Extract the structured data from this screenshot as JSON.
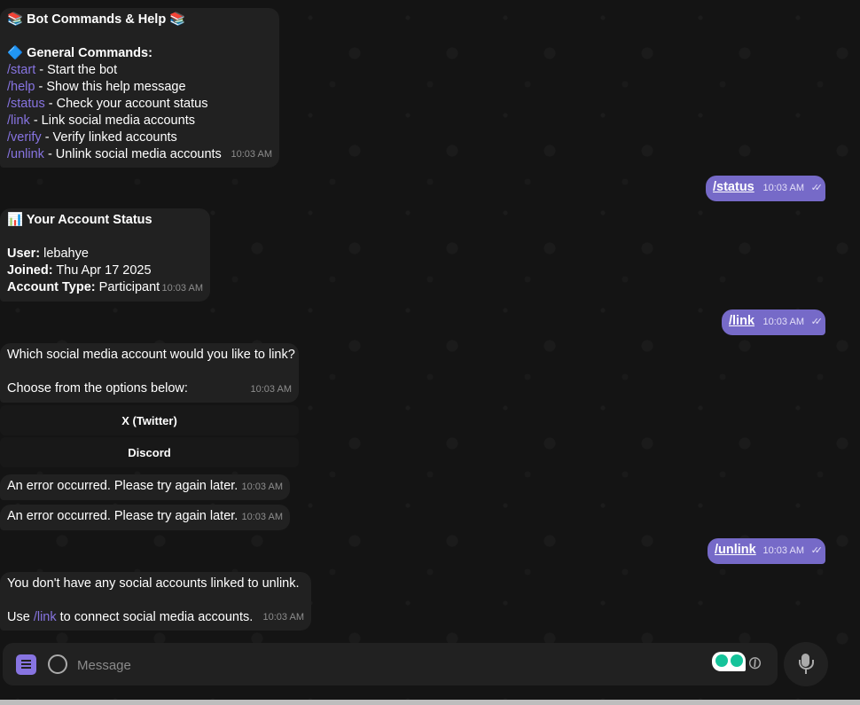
{
  "messages": {
    "help": {
      "title": "📚 Bot Commands & Help 📚",
      "section": "🔷 General Commands:",
      "commands": [
        {
          "cmd": "/start",
          "desc": " - Start the bot"
        },
        {
          "cmd": "/help",
          "desc": " - Show this help message"
        },
        {
          "cmd": "/status",
          "desc": " - Check your account status"
        },
        {
          "cmd": "/link",
          "desc": " - Link social media accounts"
        },
        {
          "cmd": "/verify",
          "desc": " - Verify linked accounts"
        },
        {
          "cmd": "/unlink",
          "desc": " - Unlink social media accounts"
        }
      ],
      "time": "10:03 AM"
    },
    "out_status": {
      "text": "/status",
      "time": "10:03 AM"
    },
    "status": {
      "title": "📊 Your Account Status",
      "user_label": "User:",
      "user_value": " lebahye",
      "joined_label": "Joined:",
      "joined_value": " Thu Apr 17 2025",
      "type_label": "Account Type:",
      "type_value": " Participant",
      "time": "10:03 AM"
    },
    "out_link": {
      "text": "/link",
      "time": "10:03 AM"
    },
    "link_prompt": {
      "line1": "Which social media account would you like to link?",
      "line2": "Choose from the options below:",
      "time": "10:03 AM"
    },
    "keyboard": {
      "buttons": [
        "X (Twitter)",
        "Discord"
      ]
    },
    "error1": {
      "text": "An error occurred. Please try again later.",
      "time": "10:03 AM"
    },
    "error2": {
      "text": "An error occurred. Please try again later.",
      "time": "10:03 AM"
    },
    "out_unlink": {
      "text": "/unlink",
      "time": "10:03 AM"
    },
    "unlink_reply": {
      "line1": "You don't have any social accounts linked to unlink.",
      "line2_pre": "Use ",
      "line2_cmd": "/link",
      "line2_post": " to connect social media accounts.",
      "time": "10:03 AM"
    }
  },
  "composer": {
    "placeholder": "Message"
  },
  "icons": {
    "menu": "menu-icon",
    "emoji": "emoji-icon",
    "extension": "grammarly-icon",
    "attach": "paperclip-icon",
    "mic": "microphone-icon",
    "read": "double-check-icon"
  },
  "colors": {
    "background": "#121212",
    "incoming_bubble": "#212121",
    "outgoing_bubble": "#766ac8",
    "command_link": "#8774e1"
  }
}
